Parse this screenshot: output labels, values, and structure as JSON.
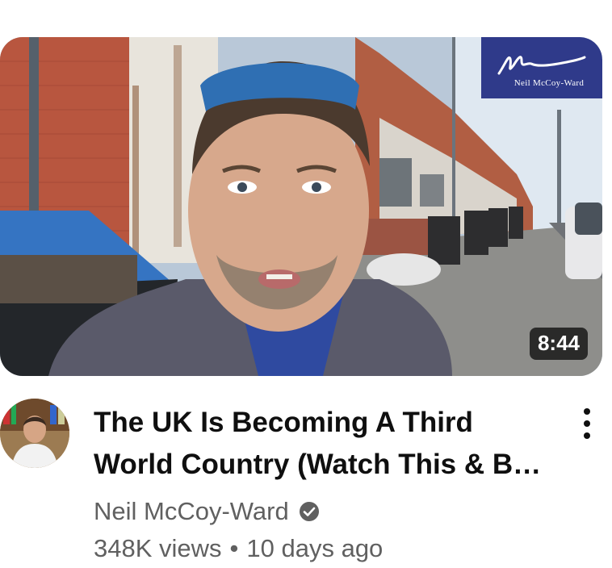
{
  "video": {
    "duration": "8:44",
    "title": "The UK Is Becoming A Third World Country (Watch This & Be Ready)",
    "logo_text": "Neil McCoy-Ward",
    "more_icon": "vertical-ellipsis-icon"
  },
  "channel": {
    "name": "Neil McCoy-Ward",
    "verified_icon": "verified-check-icon"
  },
  "stats": {
    "views": "348K views",
    "separator": "•",
    "age": "10 days ago"
  },
  "colors": {
    "logo_bg": "#2f3a8a",
    "meta_text": "#606060",
    "title_text": "#0f0f0f"
  }
}
